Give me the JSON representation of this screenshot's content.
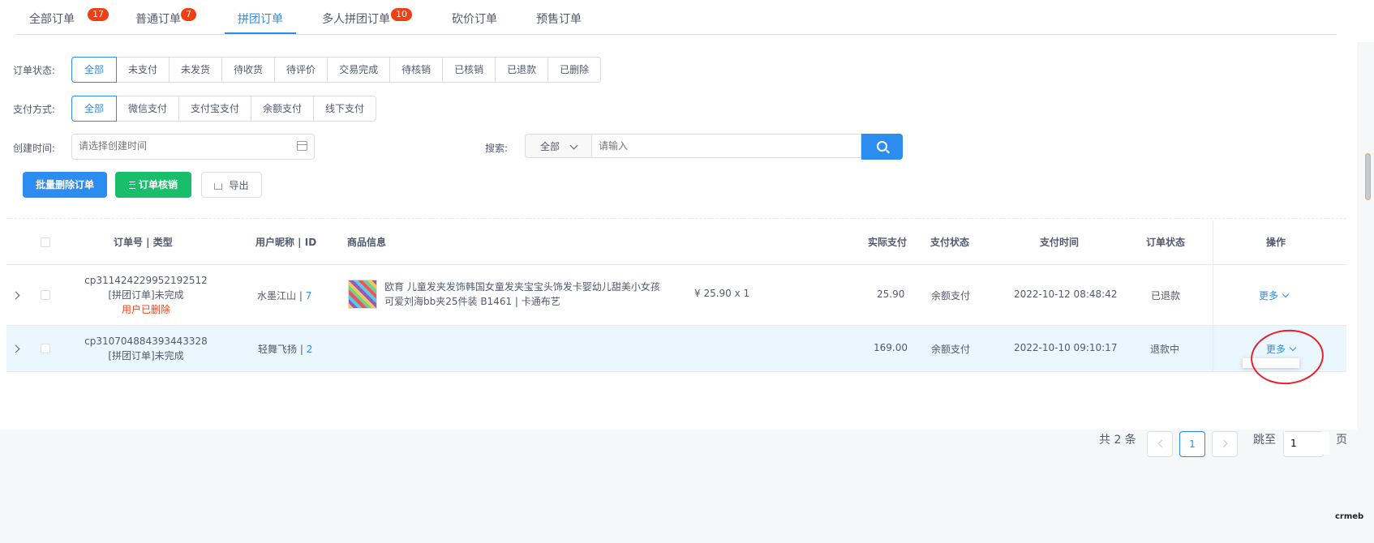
{
  "tabs": [
    {
      "label": "全部订单",
      "badge": "17"
    },
    {
      "label": "普通订单",
      "badge": "7"
    },
    {
      "label": "拼团订单",
      "badge": ""
    },
    {
      "label": "多人拼团订单",
      "badge": "10"
    },
    {
      "label": "砍价订单",
      "badge": ""
    },
    {
      "label": "预售订单",
      "badge": ""
    }
  ],
  "filters": {
    "status_label": "订单状态:",
    "status_options": [
      "全部",
      "未支付",
      "未发货",
      "待收货",
      "待评价",
      "交易完成",
      "待核销",
      "已核销",
      "已退款",
      "已删除"
    ],
    "status_selected": "全部",
    "pay_label": "支付方式:",
    "pay_options": [
      "全部",
      "微信支付",
      "支付宝支付",
      "余额支付",
      "线下支付"
    ],
    "pay_selected": "全部",
    "date_label": "创建时间:",
    "date_placeholder": "请选择创建时间",
    "search_label": "搜索:",
    "search_scope": "全部",
    "search_placeholder": "请输入"
  },
  "actions": {
    "batch_delete": "批量删除订单",
    "verify": "订单核销",
    "export": "导出"
  },
  "table": {
    "headers": [
      "订单号 | 类型",
      "用户昵称 | ID",
      "商品信息",
      "实际支付",
      "支付状态",
      "支付时间",
      "订单状态",
      "操作"
    ],
    "rows": [
      {
        "order_no": "cp311424229952192512",
        "type": "[拼团订单]未完成",
        "note": "用户已删除",
        "nickname": "水墨江山",
        "sep": " | ",
        "uid": "7",
        "product_line1": "欧育 儿童发夹发饰韩国女童发夹宝宝头饰发卡婴幼儿甜美小女孩",
        "product_line2": "可爱刘海bb夹25件装 B1461 | 卡通布艺",
        "price_qty": "¥ 25.90 x 1",
        "paid": "25.90",
        "pay_status": "余额支付",
        "pay_time": "2022-10-12 08:48:42",
        "order_status": "已退款",
        "more": "更多"
      },
      {
        "order_no": "cp310704884393443328",
        "type": "[拼团订单]未完成",
        "note": "",
        "nickname": "轻舞飞扬",
        "sep": " | ",
        "uid": "2",
        "product_line1": "",
        "product_line2": "",
        "price_qty": "",
        "paid": "169.00",
        "pay_status": "余额支付",
        "pay_time": "2022-10-10 09:10:17",
        "order_status": "退款中",
        "more": "更多"
      }
    ]
  },
  "pagination": {
    "total": "共 2 条",
    "current": "1",
    "jump_label": "跳至",
    "jump_value": "1",
    "page_unit": "页"
  },
  "brand": "crmeb",
  "colors": {
    "primary": "#2d8cf0",
    "success": "#19be6b",
    "danger": "#ed4014",
    "annotation": "#e8212c"
  }
}
